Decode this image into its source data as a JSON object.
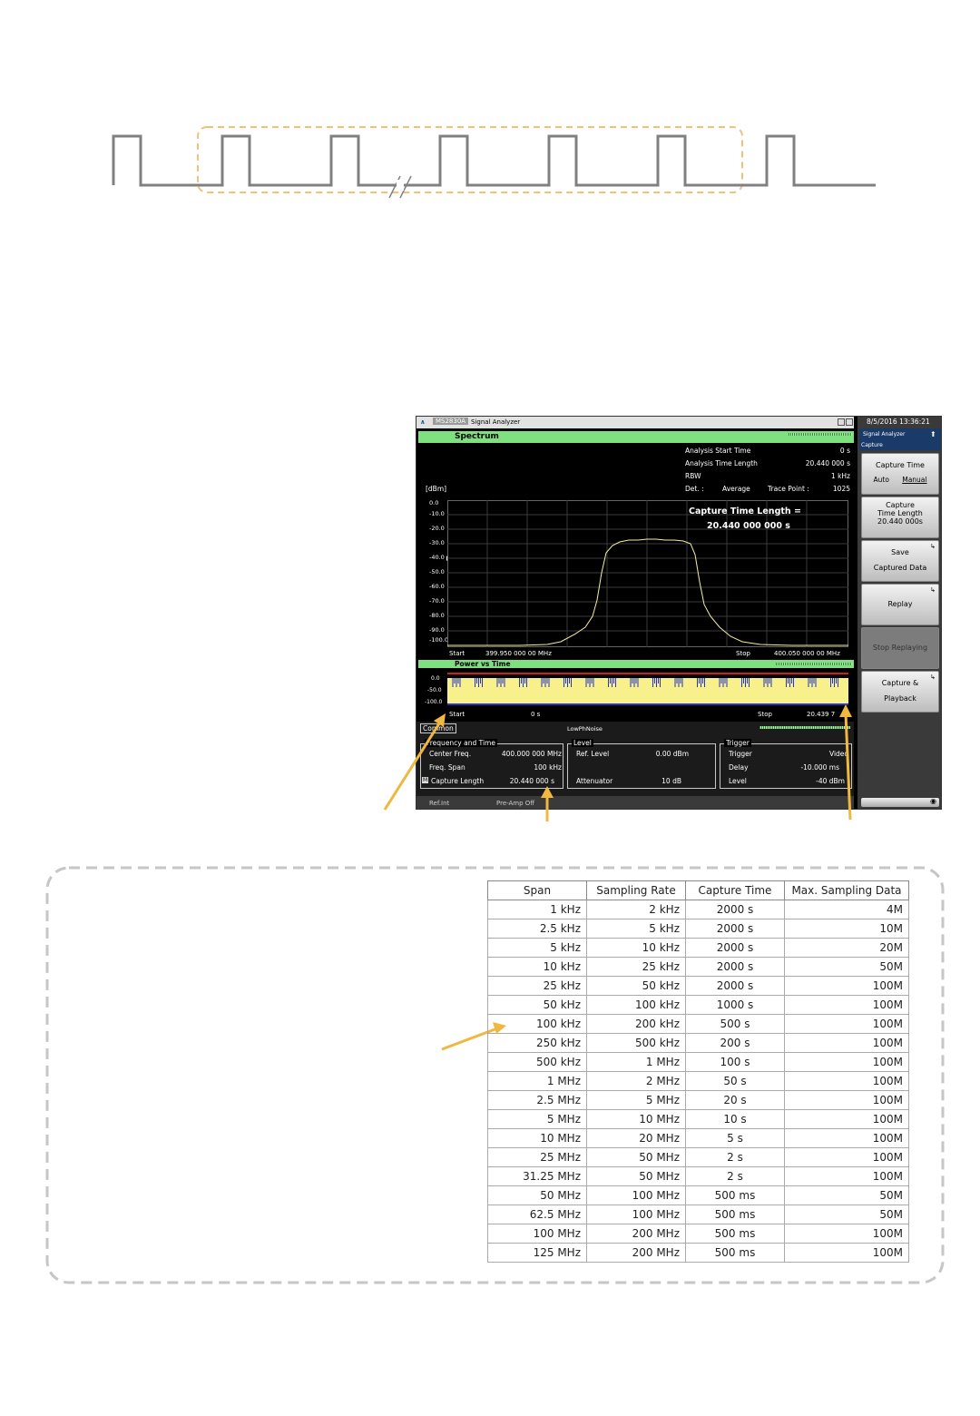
{
  "pulse_diagram": {
    "description_visible": false
  },
  "analyzer": {
    "model": "MS2830A",
    "app": "Signal Analyzer",
    "datetime": "8/5/2016 13:36:21",
    "header_app": "Signal Analyzer",
    "header_sub": "Capture",
    "spectrum_title": "Spectrum",
    "info": {
      "analysis_start_label": "Analysis Start Time",
      "analysis_start_value": "0 s",
      "analysis_length_label": "Analysis Time Length",
      "analysis_length_value": "20.440 000 s",
      "rbw_label": "RBW",
      "rbw_value": "1 kHz",
      "det_label": "Det. :",
      "det_value": "Average",
      "trace_label": "Trace Point :",
      "trace_value": "1025"
    },
    "unit": "[dBm]",
    "y_ticks": [
      "0.0",
      "-10.0",
      "-20.0",
      "-30.0",
      "-40.0",
      "-50.0",
      "-60.0",
      "-70.0",
      "-80.0",
      "-90.0",
      "-100.0"
    ],
    "annotation_line1": "Capture Time Length =",
    "annotation_line2": "20.440 000 000 s",
    "start_label": "Start",
    "start_value": "399.950 000 00 MHz",
    "stop_label": "Stop",
    "stop_value": "400.050 000 00 MHz",
    "pvt_title": "Power vs Time",
    "pvt_ticks": [
      "0.0",
      "-50.0",
      "-100.0"
    ],
    "pvt_start_label": "Start",
    "pvt_start_value": "0 s",
    "pvt_stop_label": "Stop",
    "pvt_stop_value": "20.439 7",
    "common_tab": "Common",
    "lowphnoise": "LowPhNoise",
    "freq_panel": {
      "title": "Frequency and Time",
      "center_label": "Center Freq.",
      "center_value": "400.000 000 MHz",
      "span_label": "Freq. Span",
      "span_value": "100 kHz",
      "capture_label": "Capture Length",
      "capture_value": "20.440 000 s",
      "capture_marker": "M"
    },
    "level_panel": {
      "title": "Level",
      "ref_label": "Ref. Level",
      "ref_value": "0.00 dBm",
      "att_label": "Attenuator",
      "att_value": "10 dB"
    },
    "trigger_panel": {
      "title": "Trigger",
      "trig_label": "Trigger",
      "trig_value": "Video",
      "delay_label": "Delay",
      "delay_value": "-10.000 ms",
      "level_label": "Level",
      "level_value": "-40 dBm"
    },
    "status_ref": "Ref.Int",
    "status_preamp": "Pre-Amp Off",
    "softkeys": {
      "capture_time": "Capture Time",
      "auto": "Auto",
      "manual": "Manual",
      "ctl_1": "Capture",
      "ctl_2": "Time Length",
      "ctl_3": "20.440 000s",
      "save_1": "Save",
      "save_2": "Captured Data",
      "replay": "Replay",
      "stop_replay": "Stop Replaying",
      "cp_1": "Capture &",
      "cp_2": "Playback"
    }
  },
  "table": {
    "headers": [
      "Span",
      "Sampling Rate",
      "Capture Time",
      "Max. Sampling Data"
    ],
    "rows": [
      [
        "1 kHz",
        "2 kHz",
        "2000 s",
        "4M"
      ],
      [
        "2.5 kHz",
        "5 kHz",
        "2000 s",
        "10M"
      ],
      [
        "5 kHz",
        "10 kHz",
        "2000 s",
        "20M"
      ],
      [
        "10 kHz",
        "25 kHz",
        "2000 s",
        "50M"
      ],
      [
        "25 kHz",
        "50 kHz",
        "2000 s",
        "100M"
      ],
      [
        "50 kHz",
        "100 kHz",
        "1000 s",
        "100M"
      ],
      [
        "100 kHz",
        "200 kHz",
        "500 s",
        "100M"
      ],
      [
        "250 kHz",
        "500 kHz",
        "200 s",
        "100M"
      ],
      [
        "500 kHz",
        "1 MHz",
        "100 s",
        "100M"
      ],
      [
        "1 MHz",
        "2 MHz",
        "50 s",
        "100M"
      ],
      [
        "2.5 MHz",
        "5 MHz",
        "20 s",
        "100M"
      ],
      [
        "5 MHz",
        "10 MHz",
        "10 s",
        "100M"
      ],
      [
        "10 MHz",
        "20 MHz",
        "5 s",
        "100M"
      ],
      [
        "25 MHz",
        "50 MHz",
        "2 s",
        "100M"
      ],
      [
        "31.25 MHz",
        "50 MHz",
        "2 s",
        "100M"
      ],
      [
        "50 MHz",
        "100 MHz",
        "500 ms",
        "50M"
      ],
      [
        "62.5 MHz",
        "100 MHz",
        "500 ms",
        "50M"
      ],
      [
        "100 MHz",
        "200 MHz",
        "500 ms",
        "100M"
      ],
      [
        "125 MHz",
        "200 MHz",
        "500 ms",
        "100M"
      ]
    ]
  },
  "colors": {
    "accent_arrow": "#f0b840",
    "screen_green": "#7fe07f",
    "trace_yellow": "#f8f08a",
    "trace_blue": "#2233cc"
  }
}
